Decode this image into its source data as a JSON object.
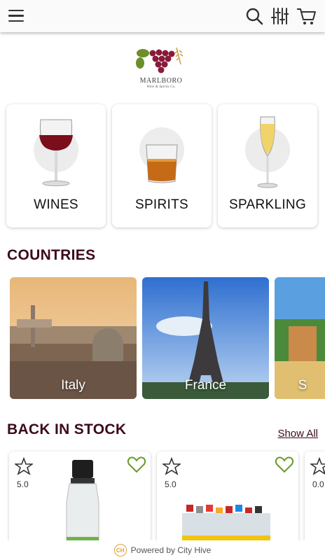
{
  "header": {
    "menu_icon": "hamburger-menu-icon",
    "search_icon": "search-icon",
    "filter_icon": "filter-icon",
    "cart_icon": "cart-icon"
  },
  "logo": {
    "name": "MARLBORO",
    "tagline": "Wine & Spirits Co."
  },
  "categories": [
    {
      "label": "WINES",
      "icon": "wine-glass-icon"
    },
    {
      "label": "SPIRITS",
      "icon": "whiskey-glass-icon"
    },
    {
      "label": "SPARKLING",
      "icon": "champagne-flute-icon"
    }
  ],
  "countries": {
    "title": "COUNTRIES",
    "items": [
      {
        "name": "Italy"
      },
      {
        "name": "France"
      },
      {
        "name": "S"
      }
    ]
  },
  "back_in_stock": {
    "title": "BACK IN STOCK",
    "show_all": "Show All",
    "products": [
      {
        "rating": "5.0"
      },
      {
        "rating": "5.0"
      },
      {
        "rating": "0.0"
      }
    ]
  },
  "footer": {
    "text": "Powered by City Hive"
  }
}
